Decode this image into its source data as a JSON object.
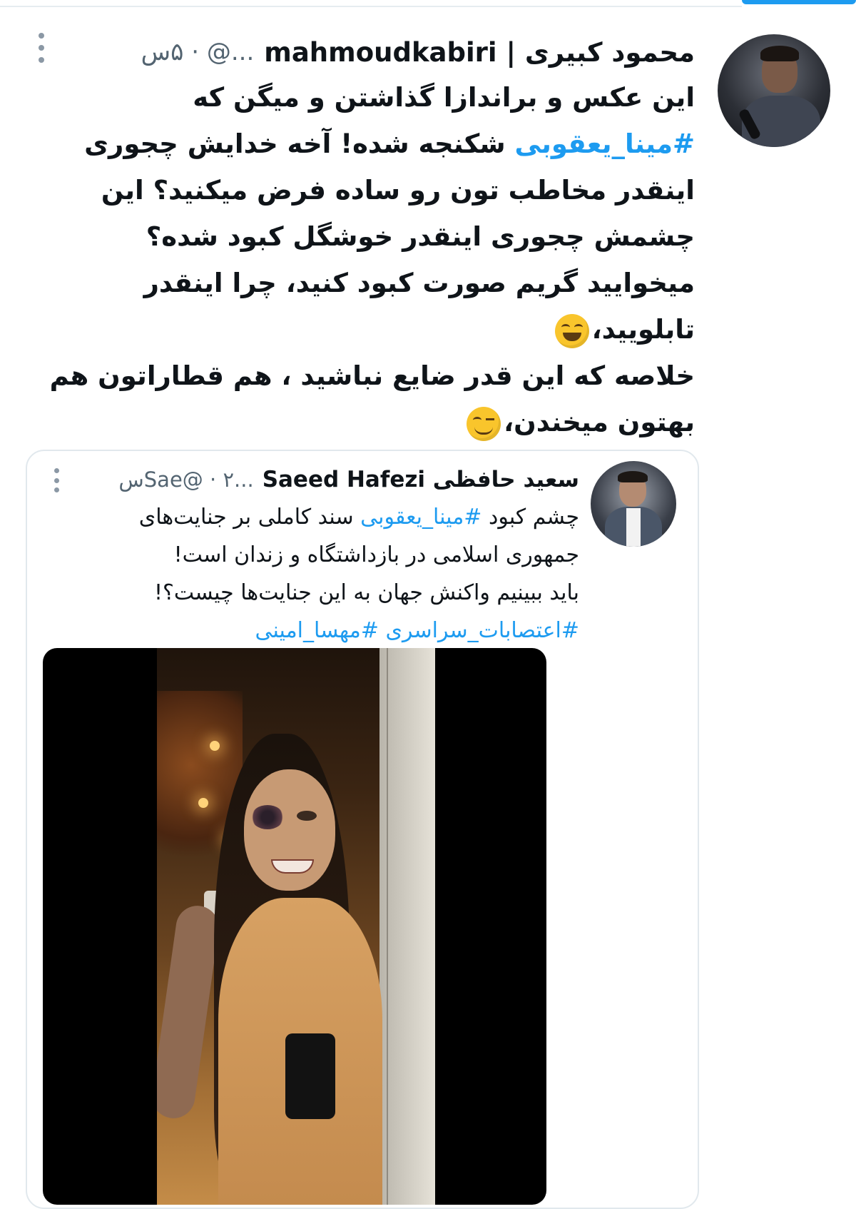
{
  "main_tweet": {
    "name": "محمود کبیری | mahmoudkabiri",
    "handle_time": "...@ · ۵س",
    "lines": [
      {
        "text": "این عکس و براندازا گذاشتن و میگن که"
      },
      {
        "hashtag": "#مینا_یعقوبی",
        "text": " شکنجه شده! آخه خدایش چجوری"
      },
      {
        "text": "اینقدر مخاطب تون رو ساده فرض میکنید؟ این"
      },
      {
        "text": "چشمش چجوری اینقدر خوشگل کبود شده؟"
      },
      {
        "text": "میخوایید گریم صورت کبود کنید، چرا اینقدر"
      },
      {
        "text": "تابلویید،",
        "emoji": "grinning-squinting-face"
      },
      {
        "text": "خلاصه که این قدر ضایع نباشید ، هم قطاراتون هم"
      },
      {
        "text": "بهتون میخندن،",
        "emoji": "winking-face"
      }
    ]
  },
  "quoted_tweet": {
    "name": "سعید حافظی Saeed Hafezi",
    "handle_time": "...Sae@ · ۲س",
    "lines": [
      {
        "text_before": "چشم کبود ",
        "hashtag": "#مینا_یعقوبی",
        "text": " سند کاملی بر جنایت‌های"
      },
      {
        "text": "جمهوری اسلامی در بازداشتگاه و زندان است!"
      },
      {
        "text": "باید ببینیم واکنش جهان به این جنایت‌ها چیست؟!"
      },
      {
        "hashtag": "#اعتصابات_سراسری #مهسا_امینی"
      }
    ]
  },
  "colors": {
    "link": "#1d9bf0",
    "text": "#0f1419",
    "secondary": "#536471",
    "border": "#e1e8ed"
  },
  "icons": [
    "more-icon",
    "avatar"
  ]
}
